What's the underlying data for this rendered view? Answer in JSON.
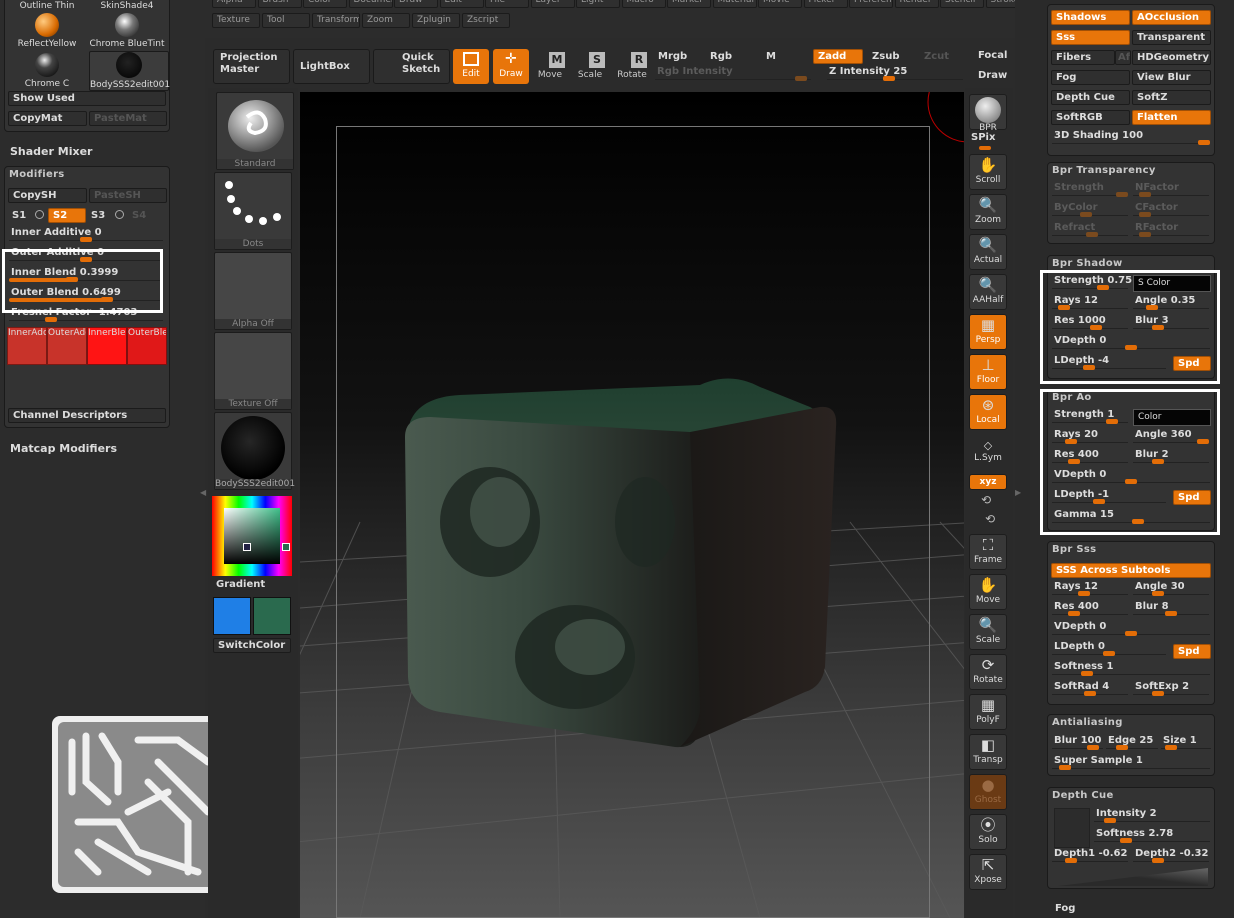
{
  "top_menu": [
    "Alpha",
    "Brush",
    "Color",
    "Document",
    "Draw",
    "Edit",
    "File",
    "Layer",
    "Light",
    "Macro",
    "Marker",
    "Material",
    "Movie",
    "Picker",
    "Preferences",
    "Render",
    "Stencil",
    "Stroke",
    "Texture",
    "Tool",
    "Transform",
    "Zoom",
    "Zplugin",
    "Zscript"
  ],
  "materials": {
    "row1": [
      "Outline Thin",
      "SkinShade4"
    ],
    "row2": [
      "ReflectYellow",
      "Chrome BlueTint"
    ],
    "row3": [
      "Chrome C",
      "BodySSS2edit001"
    ],
    "show_used": "Show Used",
    "copy_mat": "CopyMat",
    "paste_mat": "PasteMat"
  },
  "shader_mixer": "Shader Mixer",
  "modifiers": {
    "title": "Modifiers",
    "copy_sh": "CopySH",
    "paste_sh": "PasteSH",
    "slots": [
      "S1",
      "S2",
      "S3",
      "S4"
    ],
    "inner_additive": {
      "label": "Inner  Additive 0",
      "value": 0.5
    },
    "outer_additive": {
      "label": "Outer  Additive 0",
      "value": 0.5
    },
    "inner_blend": {
      "label": "Inner  Blend 0.3999",
      "value": 0.4
    },
    "outer_blend": {
      "label": "Outer  Blend 0.6499",
      "value": 0.65
    },
    "fresnel": {
      "label": "Fresnel  Factor -1.4703",
      "value": 0.25
    },
    "swatches": [
      "InnerAdd",
      "OuterAdd",
      "InnerBlen",
      "OuterBlen"
    ],
    "channel_descriptors": "Channel Descriptors"
  },
  "matcap_modifiers": "Matcap Modifiers",
  "toolbar": {
    "projection_master": "Projection\nMaster",
    "lightbox": "LightBox",
    "quick_sketch": "Quick\nSketch",
    "edit": "Edit",
    "draw": "Draw",
    "move": "Move",
    "scale": "Scale",
    "rotate": "Rotate",
    "mrgb": "Mrgb",
    "rgb": "Rgb",
    "m": "M",
    "zadd": "Zadd",
    "zsub": "Zsub",
    "zcut": "Zcut",
    "focal": "Focal",
    "draw_r": "Draw",
    "rgb_intensity": "Rgb  Intensity",
    "z_intensity": "Z  Intensity 25"
  },
  "palette": {
    "brush": "Standard",
    "stroke": "Dots",
    "alpha": "Alpha  Off",
    "texture": "Texture  Off",
    "material": "BodySSS2edit001",
    "gradient": "Gradient",
    "switch_color": "SwitchColor",
    "main_color": "#1f7fe6",
    "secondary_color": "#2a6a4e"
  },
  "right_shelf": [
    "BPR",
    "SPix",
    "Scroll",
    "Zoom",
    "Actual",
    "AAHalf",
    "Persp",
    "Floor",
    "Local",
    "L.Sym",
    "xyz",
    "Frame",
    "Move",
    "Scale",
    "Rotate",
    "PolyF",
    "Transp",
    "Ghost",
    "Solo",
    "Xpose"
  ],
  "render": {
    "shadows": "Shadows",
    "aocclusion": "AOcclusion",
    "sss": "Sss",
    "transparent": "Transparent",
    "fibers": "Fibers",
    "af": "Af",
    "hdgeometry": "HDGeometry",
    "fog": "Fog",
    "view_blur": "View  Blur",
    "depth_cue": "Depth  Cue",
    "softz": "SoftZ",
    "softrgb": "SoftRGB",
    "flatten": "Flatten",
    "shading_3d": {
      "label": "3D  Shading 100",
      "value": 1.0
    }
  },
  "bpr_transparency": {
    "title": "Bpr  Transparency",
    "strength": "Strength",
    "nfactor": "NFactor",
    "bycolor": "ByColor",
    "cfactor": "CFactor",
    "refract": "Refract",
    "rfactor": "RFactor"
  },
  "bpr_shadow": {
    "title": "Bpr  Shadow",
    "strength": {
      "label": "Strength 0.75",
      "value": 0.7
    },
    "color": "S  Color",
    "rays": {
      "label": "Rays 12",
      "value": 0.1
    },
    "angle": {
      "label": "Angle 0.35",
      "value": 0.2
    },
    "res": {
      "label": "Res 1000",
      "value": 0.6
    },
    "blur": {
      "label": "Blur 3",
      "value": 0.3
    },
    "vdepth": {
      "label": "VDepth 0",
      "value": 0.5
    },
    "ldepth": {
      "label": "LDepth -4",
      "value": 0.3
    },
    "spd": "Spd"
  },
  "bpr_ao": {
    "title": "Bpr  Ao",
    "strength": {
      "label": "Strength 1",
      "value": 0.85
    },
    "color": "Color",
    "rays": {
      "label": "Rays 20",
      "value": 0.2
    },
    "angle": {
      "label": "Angle 360",
      "value": 1.0
    },
    "res": {
      "label": "Res 400",
      "value": 0.25
    },
    "blur": {
      "label": "Blur 2",
      "value": 0.3
    },
    "vdepth": {
      "label": "VDepth 0",
      "value": 0.5
    },
    "ldepth": {
      "label": "LDepth -1",
      "value": 0.4
    },
    "spd": "Spd",
    "gamma": {
      "label": "Gamma 15",
      "value": 0.55
    }
  },
  "bpr_sss": {
    "title": "Bpr  Sss",
    "across": "SSS  Across  Subtools",
    "rays": {
      "label": "Rays 12",
      "value": 0.4
    },
    "angle": {
      "label": "Angle 30",
      "value": 0.3
    },
    "res": {
      "label": "Res 400",
      "value": 0.25
    },
    "blur": {
      "label": "Blur 8",
      "value": 0.5
    },
    "vdepth": {
      "label": "VDepth 0",
      "value": 0.5
    },
    "ldepth": {
      "label": "LDepth 0",
      "value": 0.5
    },
    "spd": "Spd",
    "softness": {
      "label": "Softness 1",
      "value": 0.2
    },
    "softrad": {
      "label": "SoftRad 4",
      "value": 0.5
    },
    "softexp": {
      "label": "SoftExp 2",
      "value": 0.3
    }
  },
  "antialiasing": {
    "title": "Antialiasing",
    "blur": {
      "label": "Blur 100",
      "value": 0.9
    },
    "edge": {
      "label": "Edge 25",
      "value": 0.25
    },
    "size": {
      "label": "Size 1",
      "value": 0.1
    },
    "super_sample": {
      "label": "Super  Sample 1",
      "value": 0.05
    }
  },
  "depth_cue_panel": {
    "title": "Depth  Cue",
    "intensity": {
      "label": "Intensity 2",
      "value": 0.1
    },
    "softness": {
      "label": "Softness 2.78",
      "value": 0.25
    },
    "depth1": {
      "label": "Depth1 -0.62",
      "value": 0.2
    },
    "depth2": {
      "label": "Depth2 -0.32",
      "value": 0.3
    }
  },
  "fog_label": "Fog"
}
